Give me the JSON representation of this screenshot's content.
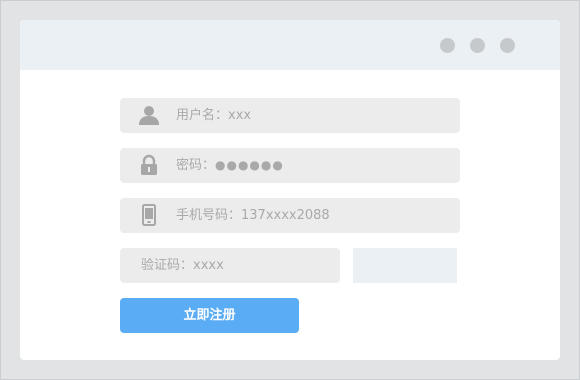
{
  "window": {
    "controls": [
      "dot",
      "dot",
      "dot"
    ]
  },
  "form": {
    "username": {
      "label": "用户名：xxx",
      "icon": "user-icon"
    },
    "password": {
      "label": "密码：",
      "mask": "●●●●●●",
      "icon": "lock-icon"
    },
    "phone": {
      "label": "手机号码：137xxxx2088",
      "icon": "phone-icon"
    },
    "captcha": {
      "label": "验证码：xxxx"
    },
    "submit_label": "立即注册"
  },
  "colors": {
    "background": "#e2e3e5",
    "titlebar": "#ebf0f4",
    "field": "#ececec",
    "button": "#5aacf5",
    "placeholder_text": "#a9a9a9"
  }
}
